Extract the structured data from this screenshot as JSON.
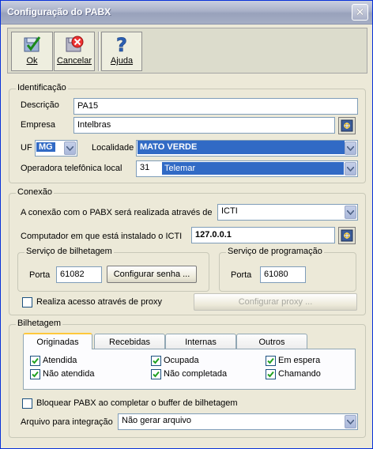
{
  "window": {
    "title": "Configuração do PABX"
  },
  "toolbar": {
    "ok": "Ok",
    "cancel": "Cancelar",
    "help": "Ajuda"
  },
  "identificacao": {
    "legend": "Identificação",
    "descricao_label": "Descrição",
    "descricao_value": "PA15",
    "empresa_label": "Empresa",
    "empresa_value": "Intelbras",
    "uf_label": "UF",
    "uf_value": "MG",
    "localidade_label": "Localidade",
    "localidade_value": "MATO VERDE",
    "operadora_label": "Operadora telefônica local",
    "operadora_code": "31",
    "operadora_name": "Telemar"
  },
  "conexao": {
    "legend": "Conexão",
    "via_label": "A conexão com o PABX será realizada através de",
    "via_value": "ICTI",
    "computador_label": "Computador em que está instalado o ICTI",
    "computador_value": "127.0.0.1",
    "bilhetagem_service": {
      "legend": "Serviço de bilhetagem",
      "porta_label": "Porta",
      "porta_value": "61082",
      "config_senha_button": "Configurar senha ..."
    },
    "programacao_service": {
      "legend": "Serviço de programação",
      "porta_label": "Porta",
      "porta_value": "61080"
    },
    "proxy_checkbox": "Realiza acesso através de proxy",
    "config_proxy_button": "Configurar proxy ..."
  },
  "bilhetagem": {
    "legend": "Bilhetagem",
    "tabs": [
      "Originadas",
      "Recebidas",
      "Internas",
      "Outros"
    ],
    "active_tab": "Originadas",
    "options": {
      "atendida": "Atendida",
      "nao_atendida": "Não atendida",
      "ocupada": "Ocupada",
      "nao_completada": "Não completada",
      "em_espera": "Em espera",
      "chamando": "Chamando"
    },
    "bloquear_checkbox": "Bloquear PABX ao completar o buffer de bilhetagem",
    "arquivo_label": "Arquivo para integração",
    "arquivo_value": "Não gerar arquivo"
  },
  "colors": {
    "selection": "#316ac5",
    "active_tab_accent": "#ffc83c",
    "check": "#21a121"
  }
}
